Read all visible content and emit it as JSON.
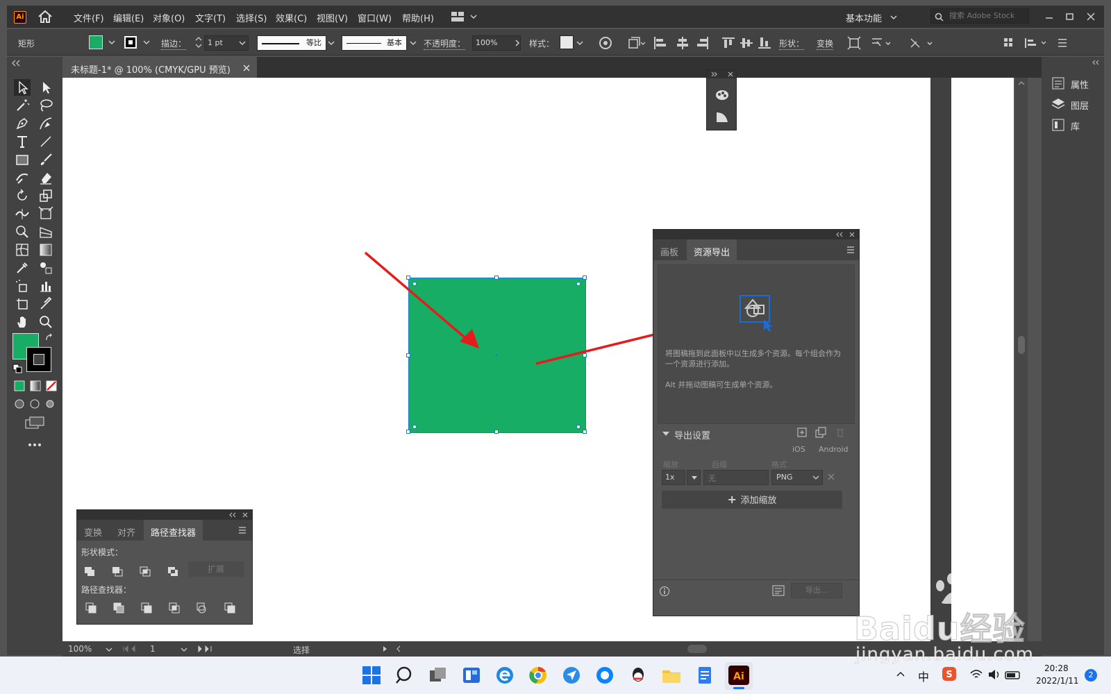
{
  "app": {
    "logo": "Ai"
  },
  "menu": [
    "文件(F)",
    "编辑(E)",
    "对象(O)",
    "文字(T)",
    "选择(S)",
    "效果(C)",
    "视图(V)",
    "窗口(W)",
    "帮助(H)"
  ],
  "workspace": "基本功能",
  "search": {
    "placeholder": "搜索 Adobe Stock"
  },
  "control": {
    "object_type": "矩形",
    "stroke_label": "描边：",
    "stroke_value": "1 pt",
    "profile_label": "等比",
    "brush_label": "基本",
    "opacity_label": "不透明度：",
    "opacity_value": "100%",
    "style_label": "样式：",
    "shape_label": "形状：",
    "transform_label": "变换",
    "fill_color": "#17ad64"
  },
  "document": {
    "tab": "未标题-1* @ 100% (CMYK/GPU 预览)"
  },
  "right_panel": [
    "属性",
    "图层",
    "库"
  ],
  "asset_export": {
    "tabs": [
      "画板",
      "资源导出"
    ],
    "hint1": "将图稿拖到此面板中以生成多个资源。每个组会作为一个资源进行添加。",
    "hint2": "Alt 并拖动图稿可生成单个资源。",
    "settings_title": "导出设置",
    "ios": "iOS",
    "android": "Android",
    "col_scale": "缩放",
    "col_suffix": "后缀",
    "col_format": "格式",
    "scale_value": "1x",
    "suffix_placeholder": "无",
    "format_value": "PNG",
    "add_scale": "添加缩放",
    "export_button": "导出..."
  },
  "pathfinder": {
    "tabs": [
      "变换",
      "对齐",
      "路径查找器"
    ],
    "shape_modes": "形状模式：",
    "expand": "扩展",
    "pathfinders": "路径查找器："
  },
  "status": {
    "zoom": "100%",
    "artboard": "1",
    "tool": "选择"
  },
  "taskbar": {
    "ime": "中",
    "time": "20:28",
    "date": "2022/1/11",
    "notifications": "2"
  },
  "watermark": {
    "brand": "Baidu经验",
    "url": "jingyan.baidu.com"
  }
}
